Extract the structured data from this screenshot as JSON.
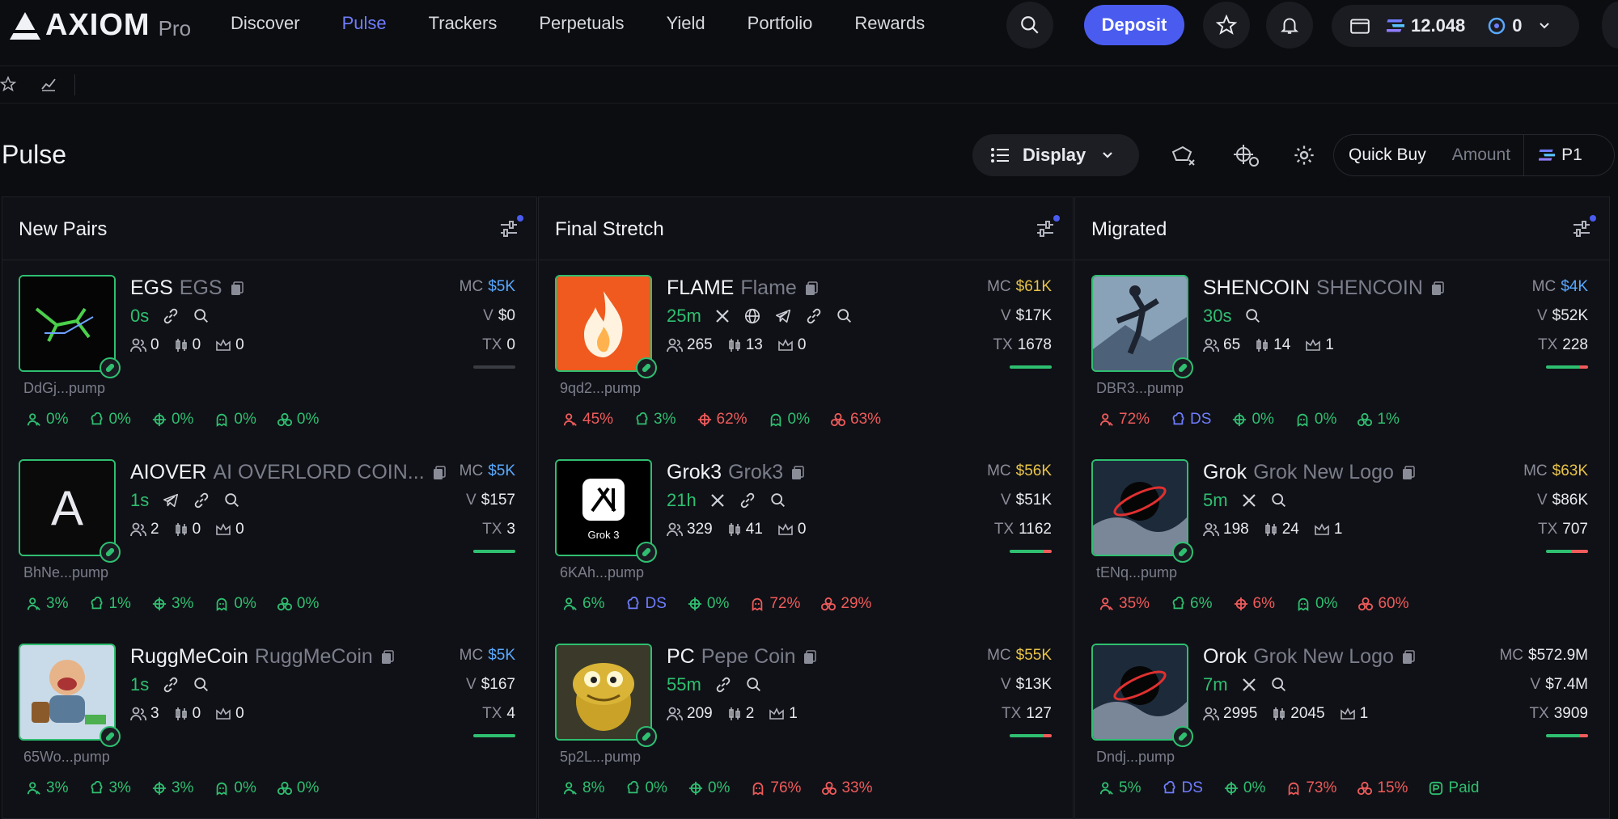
{
  "header": {
    "brand": "AXIOM",
    "brand_suffix": "Pro",
    "nav": [
      "Discover",
      "Pulse",
      "Trackers",
      "Perpetuals",
      "Yield",
      "Portfolio",
      "Rewards"
    ],
    "active_nav": "Pulse",
    "deposit_label": "Deposit",
    "balance": "12.048",
    "points": "0"
  },
  "page": {
    "title": "Pulse",
    "display_label": "Display",
    "quick_buy_label": "Quick Buy",
    "amount_placeholder": "Amount",
    "preset": "P1"
  },
  "columns": [
    {
      "title": "New Pairs",
      "cards": [
        {
          "ticker": "EGS",
          "name": "EGS",
          "age": "0s",
          "socials": [
            "link",
            "search"
          ],
          "holders": "0",
          "snipers": "0",
          "proTraders": "0",
          "address": "DdGj...pump",
          "mc": "$5K",
          "mcColor": "blue",
          "vol": "$0",
          "tx": "0",
          "txbar": 0,
          "pcts": [
            [
              "user",
              "0%",
              "g"
            ],
            [
              "chef",
              "0%",
              "g"
            ],
            [
              "target",
              "0%",
              "g"
            ],
            [
              "ghost",
              "0%",
              "g"
            ],
            [
              "bundle",
              "0%",
              "g"
            ]
          ],
          "thumb": "egs"
        },
        {
          "ticker": "AIOVER",
          "name": "AI OVERLORD COIN...",
          "age": "1s",
          "socials": [
            "telegram",
            "link",
            "search"
          ],
          "holders": "2",
          "snipers": "0",
          "proTraders": "0",
          "address": "BhNe...pump",
          "mc": "$5K",
          "mcColor": "blue",
          "vol": "$157",
          "tx": "3",
          "txbar": 1,
          "pcts": [
            [
              "user",
              "3%",
              "g"
            ],
            [
              "chef",
              "1%",
              "g"
            ],
            [
              "target",
              "3%",
              "g"
            ],
            [
              "ghost",
              "0%",
              "g"
            ],
            [
              "bundle",
              "0%",
              "g"
            ]
          ],
          "thumb": "letter",
          "letter": "A"
        },
        {
          "ticker": "RuggMeCoin",
          "name": "RuggMeCoin",
          "age": "1s",
          "socials": [
            "link",
            "search"
          ],
          "holders": "3",
          "snipers": "0",
          "proTraders": "0",
          "address": "65Wo...pump",
          "mc": "$5K",
          "mcColor": "blue",
          "vol": "$167",
          "tx": "4",
          "txbar": 1,
          "pcts": [
            [
              "user",
              "3%",
              "g"
            ],
            [
              "chef",
              "3%",
              "g"
            ],
            [
              "target",
              "3%",
              "g"
            ],
            [
              "ghost",
              "0%",
              "g"
            ],
            [
              "bundle",
              "0%",
              "g"
            ]
          ],
          "thumb": "rugg"
        }
      ]
    },
    {
      "title": "Final Stretch",
      "cards": [
        {
          "ticker": "FLAME",
          "name": "Flame",
          "age": "25m",
          "socials": [
            "x",
            "globe",
            "telegram",
            "link",
            "search"
          ],
          "holders": "265",
          "snipers": "13",
          "proTraders": "0",
          "address": "9qd2...pump",
          "mc": "$61K",
          "mcColor": "gold",
          "vol": "$17K",
          "tx": "1678",
          "txbar": 1,
          "pcts": [
            [
              "user",
              "45%",
              "r"
            ],
            [
              "chef",
              "3%",
              "g"
            ],
            [
              "target",
              "62%",
              "r"
            ],
            [
              "ghost",
              "0%",
              "g"
            ],
            [
              "bundle",
              "63%",
              "r"
            ]
          ],
          "thumb": "flame"
        },
        {
          "ticker": "Grok3",
          "name": "Grok3",
          "age": "21h",
          "socials": [
            "x",
            "link",
            "search"
          ],
          "holders": "329",
          "snipers": "41",
          "proTraders": "0",
          "address": "6KAh...pump",
          "mc": "$56K",
          "mcColor": "gold",
          "vol": "$51K",
          "tx": "1162",
          "txbar": 0.8,
          "pcts": [
            [
              "user",
              "6%",
              "g"
            ],
            [
              "chef",
              "DS",
              "b"
            ],
            [
              "target",
              "0%",
              "g"
            ],
            [
              "ghost",
              "72%",
              "r"
            ],
            [
              "bundle",
              "29%",
              "r"
            ]
          ],
          "thumb": "grok3",
          "thumb_caption": "Grok 3"
        },
        {
          "ticker": "PC",
          "name": "Pepe Coin",
          "age": "55m",
          "socials": [
            "link",
            "search"
          ],
          "holders": "209",
          "snipers": "2",
          "proTraders": "1",
          "address": "5p2L...pump",
          "mc": "$55K",
          "mcColor": "gold",
          "vol": "$13K",
          "tx": "127",
          "txbar": 0.8,
          "pcts": [
            [
              "user",
              "8%",
              "g"
            ],
            [
              "chef",
              "0%",
              "g"
            ],
            [
              "target",
              "0%",
              "g"
            ],
            [
              "ghost",
              "76%",
              "r"
            ],
            [
              "bundle",
              "33%",
              "r"
            ]
          ],
          "thumb": "pepe"
        }
      ]
    },
    {
      "title": "Migrated",
      "cards": [
        {
          "ticker": "SHENCOIN",
          "name": "SHENCOIN",
          "age": "30s",
          "socials": [
            "search"
          ],
          "holders": "65",
          "snipers": "14",
          "proTraders": "1",
          "address": "DBR3...pump",
          "mc": "$4K",
          "mcColor": "blue",
          "vol": "$52K",
          "tx": "228",
          "txbar": 0.8,
          "pcts": [
            [
              "user",
              "72%",
              "r"
            ],
            [
              "chef",
              "DS",
              "b"
            ],
            [
              "target",
              "0%",
              "g"
            ],
            [
              "ghost",
              "0%",
              "g"
            ],
            [
              "bundle",
              "1%",
              "g"
            ]
          ],
          "thumb": "shen"
        },
        {
          "ticker": "Grok",
          "name": "Grok New Logo",
          "age": "5m",
          "socials": [
            "x",
            "search"
          ],
          "holders": "198",
          "snipers": "24",
          "proTraders": "1",
          "address": "tENq...pump",
          "mc": "$63K",
          "mcColor": "gold",
          "vol": "$86K",
          "tx": "707",
          "txbar": 0.6,
          "pcts": [
            [
              "user",
              "35%",
              "r"
            ],
            [
              "chef",
              "6%",
              "g"
            ],
            [
              "target",
              "6%",
              "r"
            ],
            [
              "ghost",
              "0%",
              "g"
            ],
            [
              "bundle",
              "60%",
              "r"
            ]
          ],
          "thumb": "blackhole"
        },
        {
          "ticker": "Orok",
          "name": "Grok New Logo",
          "age": "7m",
          "socials": [
            "x",
            "search"
          ],
          "holders": "2995",
          "snipers": "2045",
          "proTraders": "1",
          "address": "Dndj...pump",
          "mc": "$572.9M",
          "mcColor": "green",
          "vol": "$7.4M",
          "tx": "3909",
          "txbar": 0.8,
          "pcts": [
            [
              "user",
              "5%",
              "g"
            ],
            [
              "chef",
              "DS",
              "b"
            ],
            [
              "target",
              "0%",
              "g"
            ],
            [
              "ghost",
              "73%",
              "r"
            ],
            [
              "bundle",
              "15%",
              "r"
            ],
            [
              "paid",
              "Paid",
              "g"
            ]
          ],
          "thumb": "blackhole"
        }
      ]
    }
  ],
  "colors": {
    "accent": "#4a5cf0",
    "green": "#2fbf71",
    "red": "#ef5b5b",
    "gold": "#e8c34a",
    "blue": "#59a9ff"
  }
}
